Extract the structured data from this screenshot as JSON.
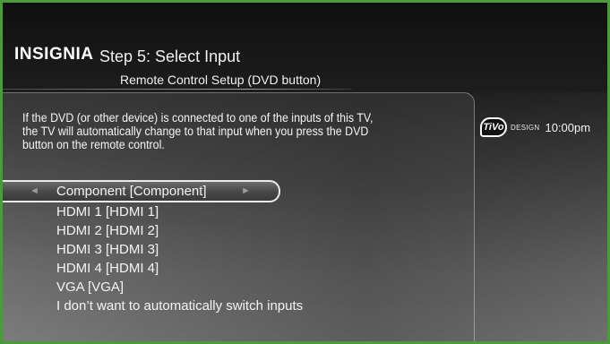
{
  "header": {
    "brand": "INSIGNIA",
    "step_title": "Step 5: Select Input",
    "subtitle": "Remote Control Setup (DVD button)"
  },
  "description": "If the DVD (or other device) is connected to one of the inputs of this TV,\nthe TV will automatically change to that input when you press the DVD\nbutton on the remote control.",
  "status": {
    "tivo_logo": "TiVo",
    "design_label": "DESIGN",
    "time": "10:00pm"
  },
  "menu": {
    "left_arrow": "◄",
    "right_arrow": "►",
    "selected_index": 0,
    "items": [
      "Component [Component]",
      "HDMI 1 [HDMI 1]",
      "HDMI 2 [HDMI 2]",
      "HDMI 3 [HDMI 3]",
      "HDMI 4 [HDMI 4]",
      "VGA [VGA]",
      "I don’t want to automatically switch inputs"
    ]
  },
  "colors": {
    "border": "#4c9a3c",
    "text": "#f4f4f4",
    "highlight_border": "#eaeaea"
  }
}
